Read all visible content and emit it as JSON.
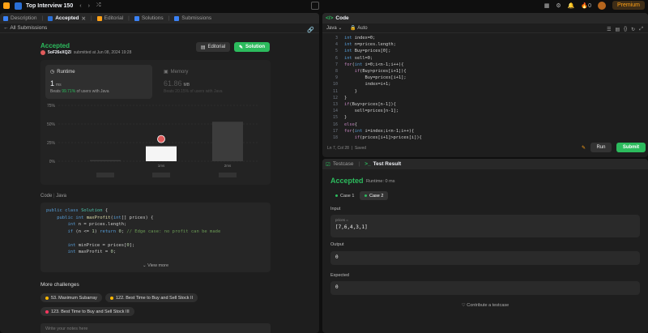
{
  "topbar": {
    "title": "Top Interview 150",
    "right_count": "0",
    "premium": "Premium"
  },
  "left_tabs": [
    "Description",
    "Accepted",
    "Editorial",
    "Solutions",
    "Submissions"
  ],
  "subbar": {
    "label": "All Submissions"
  },
  "submission": {
    "status": "Accepted",
    "user": "5oF26eXQZl",
    "submitted": "submitted at Jun 08, 2024 19:28",
    "editorial_btn": "Editorial",
    "solution_btn": "Solution"
  },
  "runtime": {
    "title": "Runtime",
    "value": "1",
    "unit": "ms",
    "beats_prefix": "Beats",
    "beats_pct": "99.71%",
    "beats_suffix": "of users with Java"
  },
  "memory": {
    "title": "Memory",
    "value": "61.86",
    "unit": "MB",
    "beats": "Beats 20.15% of users with Java"
  },
  "chart_data": {
    "type": "bar",
    "categories": [
      "0ms",
      "1ms",
      "2ms"
    ],
    "values": [
      1.5,
      20,
      53
    ],
    "ylim": [
      0,
      75
    ],
    "yticks": [
      "0%",
      "25%",
      "50%",
      "75%"
    ],
    "xlabels": [
      "",
      "1ms",
      "2ms"
    ],
    "highlight": "1ms",
    "grid": true
  },
  "code": {
    "label": "Code",
    "lang": "Java",
    "view_more": "View more"
  },
  "more": {
    "title": "More challenges",
    "items": [
      "53. Maximum Subarray",
      "122. Best Time to Buy and Sell Stock II",
      "123. Best Time to Buy and Sell Stock III"
    ]
  },
  "notes_placeholder": "Write your notes here",
  "editor": {
    "tab": "Code",
    "lang": "Java",
    "mode": "Auto",
    "line_numbers": [
      "3",
      "4",
      "5",
      "6",
      "7",
      "8",
      "9",
      "10",
      "11",
      "12",
      "13",
      "14",
      "15",
      "16",
      "17",
      "18"
    ],
    "status": "Ln 7, Col 28",
    "saved": "Saved",
    "run": "Run",
    "submit": "Submit"
  },
  "bottom_tabs": [
    "Testcase",
    "Test Result"
  ],
  "result": {
    "status": "Accepted",
    "runtime": "Runtime: 0 ms",
    "cases": [
      "Case 1",
      "Case 2"
    ],
    "input_label": "Input",
    "var_name": "prices =",
    "input_value": "[7,6,4,3,1]",
    "output_label": "Output",
    "output_value": "0",
    "expected_label": "Expected",
    "expected_value": "0",
    "contribute": "Contribute a testcase"
  }
}
